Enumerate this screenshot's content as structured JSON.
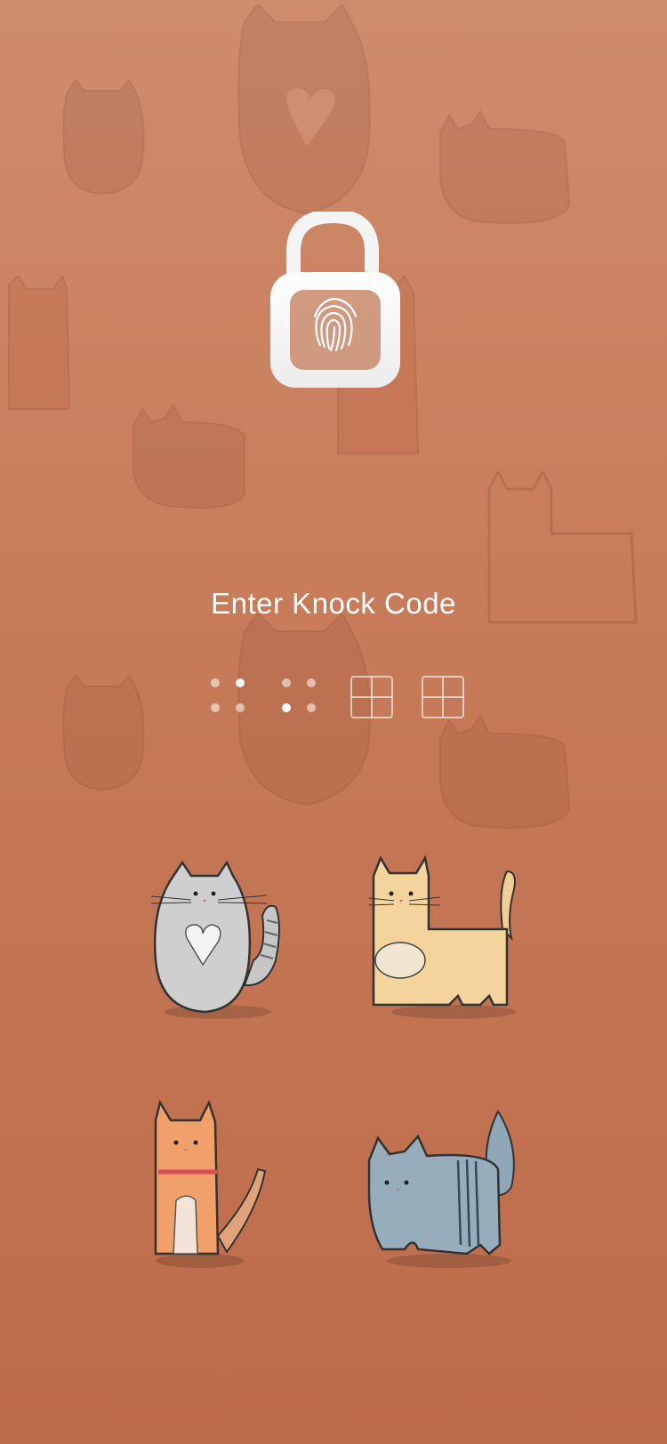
{
  "screen": {
    "title": "Enter Knock Code"
  },
  "lock_icon": {
    "icon": "padlock-fingerprint-icon",
    "state": "unlocked"
  },
  "code_indicator": {
    "slots": [
      {
        "icon": "dots-entered-icon",
        "filled": true
      },
      {
        "icon": "dots-entered-icon",
        "filled": true
      },
      {
        "icon": "grid-empty-icon",
        "filled": false
      },
      {
        "icon": "grid-empty-icon",
        "filled": false
      }
    ]
  },
  "knock_pads": [
    {
      "name": "gray-heart-cat",
      "icon": "gray-cat-icon"
    },
    {
      "name": "cream-cat",
      "icon": "cream-cat-icon"
    },
    {
      "name": "orange-cat",
      "icon": "orange-cat-icon"
    },
    {
      "name": "blue-gray-cat",
      "icon": "blue-gray-cat-icon"
    }
  ],
  "colors": {
    "background_top": "#cf8c6d",
    "background_bottom": "#bd6c4a",
    "text": "#ffffff"
  }
}
